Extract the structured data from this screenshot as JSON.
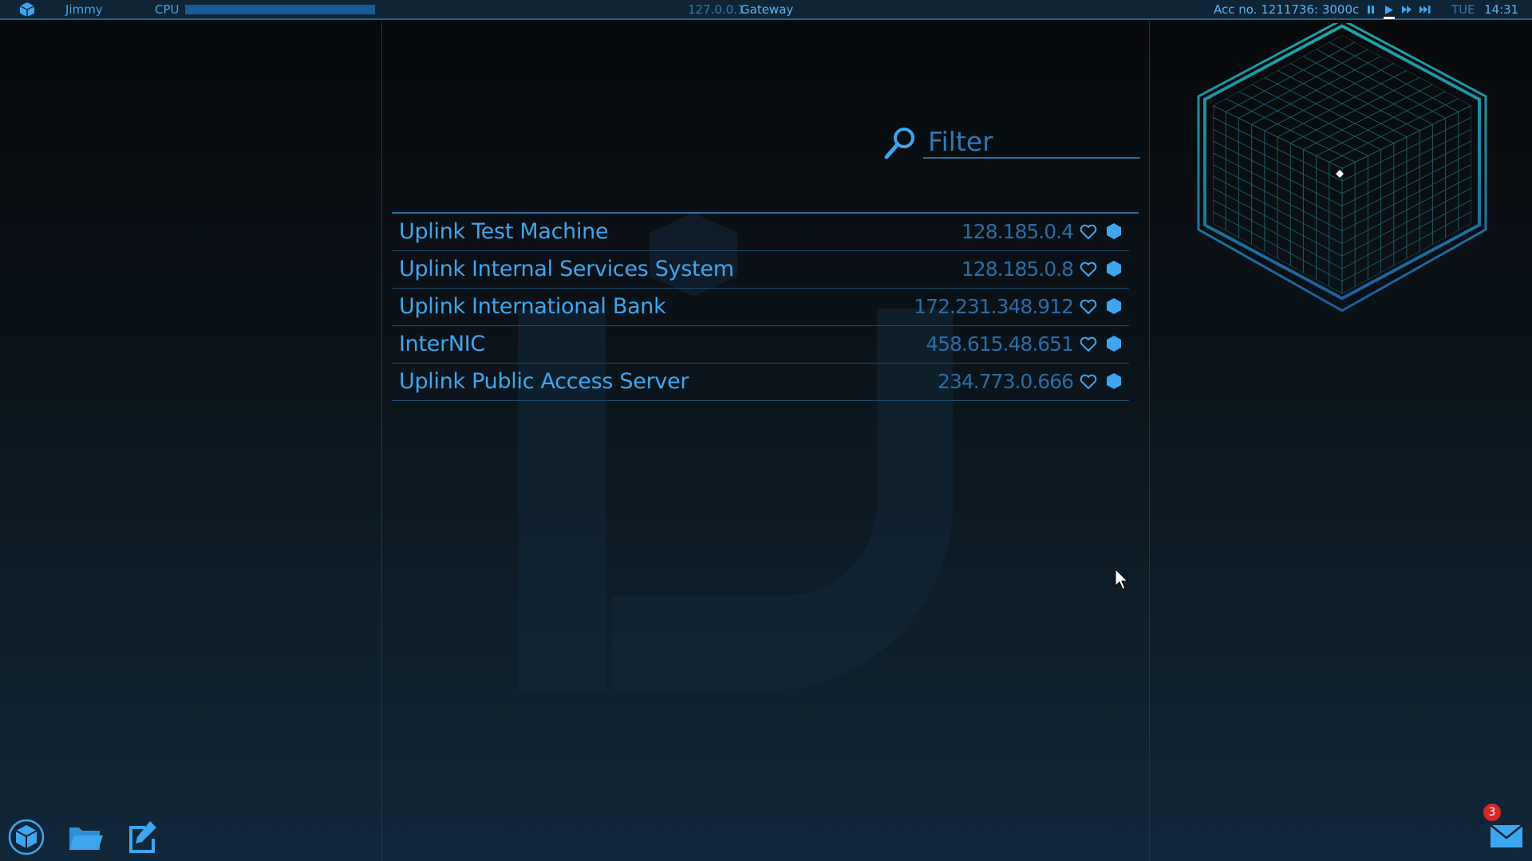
{
  "topbar": {
    "user": "Jimmy",
    "cpu_label": "CPU",
    "cpu_usage": 1.0,
    "ip": "127.0.0.1",
    "location": "Gateway",
    "account": "Acc no. 1211736: 3000c",
    "speed_controls": [
      "pause",
      "play",
      "fast-forward",
      "fastest"
    ],
    "day": "TUE",
    "time": "14:31"
  },
  "filter": {
    "placeholder": "Filter",
    "value": ""
  },
  "servers": [
    {
      "name": "Uplink Test Machine",
      "ip": "128.185.0.4"
    },
    {
      "name": "Uplink Internal Services System",
      "ip": "128.185.0.8"
    },
    {
      "name": "Uplink International Bank",
      "ip": "172.231.348.912"
    },
    {
      "name": "InterNIC",
      "ip": "458.615.48.651"
    },
    {
      "name": "Uplink Public Access Server",
      "ip": "234.773.0.666"
    }
  ],
  "dock": {
    "items": [
      "network-map-icon",
      "files-icon",
      "notes-icon"
    ]
  },
  "mail": {
    "unread_count": "3"
  },
  "colors": {
    "accent": "#3ea6f0",
    "dim": "#2a6da6",
    "badge": "#d8262a"
  }
}
